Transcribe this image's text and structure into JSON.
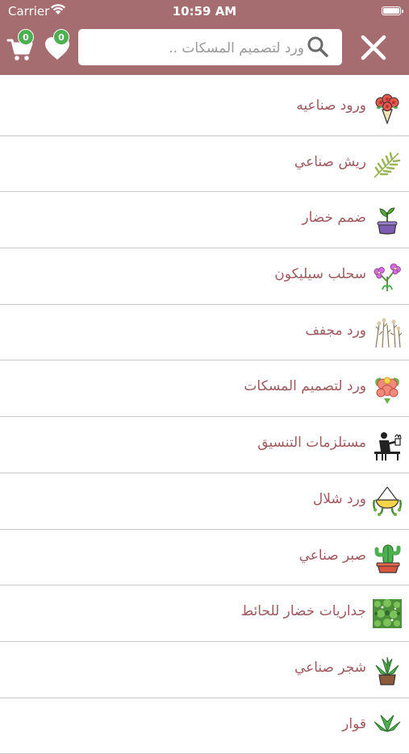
{
  "status_bar": {
    "carrier": "Carrier",
    "time": "10:59 AM"
  },
  "header": {
    "cart_count": "0",
    "favorites_count": "0",
    "search_placeholder": "ورد لتصميم المسكات ..",
    "search_value": "",
    "colors": {
      "header_bg": "#a56d70",
      "badge": "#4caf50",
      "label": "#9e5a5f"
    }
  },
  "categories": [
    {
      "label": "ورود صناعيه",
      "icon": "bouquet-icon"
    },
    {
      "label": "ريش صناعي",
      "icon": "fern-icon"
    },
    {
      "label": "ضمم خضار",
      "icon": "potted-plant-icon"
    },
    {
      "label": "سحلب سيليكون",
      "icon": "orchid-icon"
    },
    {
      "label": "ورد مجفف",
      "icon": "dried-flowers-icon"
    },
    {
      "label": "ورد لتصميم المسكات",
      "icon": "flower-bouquet-icon"
    },
    {
      "label": "مستلزمات التنسيق",
      "icon": "florist-icon"
    },
    {
      "label": "ورد شلال",
      "icon": "hanging-basket-icon"
    },
    {
      "label": "صبر صناعي",
      "icon": "cactus-icon"
    },
    {
      "label": "جداريات خضار للحائط",
      "icon": "green-wall-icon"
    },
    {
      "label": "شجر صناعي",
      "icon": "succulent-icon"
    },
    {
      "label": "قوار",
      "icon": "pot-icon"
    }
  ]
}
